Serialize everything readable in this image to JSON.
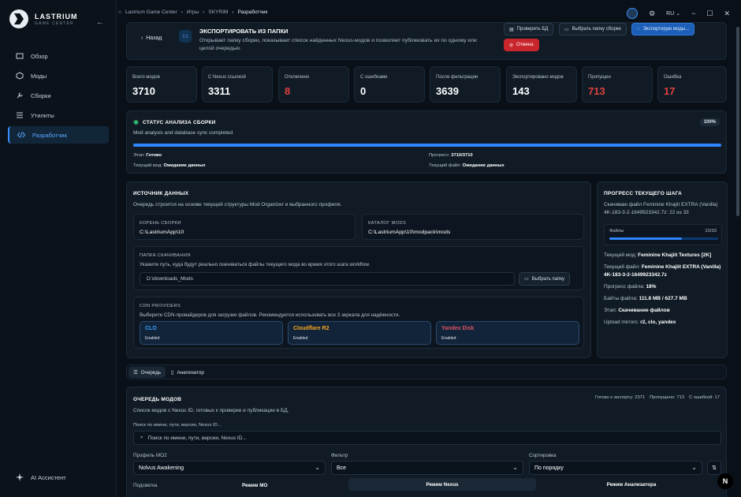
{
  "app": {
    "logo_name": "LASTRIUM",
    "logo_sub": "GAME CENTER"
  },
  "sidebar": {
    "items": [
      {
        "label": "Обзор",
        "icon": "overview-icon"
      },
      {
        "label": "Моды",
        "icon": "cube-icon"
      },
      {
        "label": "Сборки",
        "icon": "wrench-icon"
      },
      {
        "label": "Утилиты",
        "icon": "sliders-icon"
      },
      {
        "label": "Разработчик",
        "icon": "code-icon"
      }
    ],
    "ai_label": "AI Ассистент"
  },
  "breadcrumbs": [
    "Lastrium Game Center",
    "Игры",
    "SKYRIM",
    "Разработчик"
  ],
  "topbar": {
    "lang": "RU"
  },
  "header": {
    "back_label": "Назад",
    "title": "ЭКСПОРТИРОВАТЬ ИЗ ПАПКИ",
    "description": "Открывает папку сборки, показывает список найденных Nexus-модов и позволяет публиковать их по одному или целой очередью.",
    "btn_check_db": "Проверить БД",
    "btn_choose_folder": "Выбрать папку сборки",
    "btn_exporting": "Экспортирую моды...",
    "btn_cancel": "Отмена"
  },
  "stats": [
    {
      "label": "Всего модов",
      "value": "3710",
      "red": false
    },
    {
      "label": "С Nexus ссылкой",
      "value": "3311",
      "red": false
    },
    {
      "label": "Отключено",
      "value": "8",
      "red": true
    },
    {
      "label": "С ошибками",
      "value": "0",
      "red": false
    },
    {
      "label": "После фильтрации",
      "value": "3639",
      "red": false
    },
    {
      "label": "Экспортировано модов",
      "value": "143",
      "red": false
    },
    {
      "label": "Пропущен",
      "value": "713",
      "red": true
    },
    {
      "label": "Ошибка",
      "value": "17",
      "red": true
    }
  ],
  "status": {
    "title": "СТАТУС АНАЛИЗА СБОРКИ",
    "subtitle": "Mod analysis and database sync completed",
    "percent_label": "100%",
    "progress": 1.0,
    "stage_label": "Этап:",
    "stage_value": "Готово",
    "progress_label": "Прогресс:",
    "progress_value": "3710/3710",
    "current_mod_label": "Текущий мод:",
    "current_mod_value": "Ожидание данных",
    "current_file_label": "Текущий файл:",
    "current_file_value": "Ожидание данных"
  },
  "source": {
    "title": "ИСТОЧНИК ДАННЫХ",
    "subtitle": "Очередь строится на основе текущей структуры Mod Organizer и выбранного профиля.",
    "root_label": "КОРЕНЬ СБОРКИ",
    "root_value": "C:\\LastriumApp\\10",
    "mods_label": "КАТАЛОГ MODS",
    "mods_value": "C:\\LastriumApp\\10\\modpack\\mods",
    "download_title": "ПАПКА СКАЧИВАНИЯ",
    "download_desc": "Укажите путь, куда будут реально скачиваться файлы текущего мода во время этого шага workflow.",
    "download_value": "D:\\downloads_Mods",
    "choose_folder": "Выбрать папку",
    "cdn_title": "CDN PROVIDERS",
    "cdn_desc": "Выберите CDN-провайдеров для загрузки файлов. Рекомендуется использовать все 3 зеркала для надёжности.",
    "cdn": [
      {
        "name": "CLO",
        "state": "Enabled",
        "color": "#3aa0ff"
      },
      {
        "name": "Cloudflare R2",
        "state": "Enabled",
        "color": "#f5a623"
      },
      {
        "name": "Yandex Disk",
        "state": "Enabled",
        "color": "#e05263"
      }
    ]
  },
  "step": {
    "title": "ПРОГРЕСС ТЕКУЩЕГО ШАГА",
    "downloading": "Скачиваю файл Feminine Khajiit EXTRA (Vanilla) 4K-183-3-2-1649923342.7z: 22 из 33",
    "files_label": "Файлы",
    "files_count": "22/33",
    "files_progress": 0.667,
    "mod_label": "Текущий мод:",
    "mod_value": "Feminine Khajiit Textures [2K]",
    "file_label": "Текущий файл:",
    "file_value": "Feminine Khajiit EXTRA (Vanilla) 4K-183-3-2-1649923342.7z",
    "fprog_label": "Прогресс файла:",
    "fprog_value": "18%",
    "bytes_label": "Байты файла:",
    "bytes_value": "111.8 MB / 627.7 MB",
    "stage_label": "Этап:",
    "stage_value": "Скачивание файлов",
    "mirrors_label": "Upload mirrors:",
    "mirrors_value": "r2, clo, yandex"
  },
  "tabs": [
    {
      "label": "Очередь"
    },
    {
      "label": "Анализатор"
    }
  ],
  "queue": {
    "title": "ОЧЕРЕДЬ МОДОВ",
    "subtitle": "Список модов с Nexus ID, готовых к проверке и публикации в БД.",
    "ready": "Готово к экспорту: 2371",
    "skipped": "Пропущено: 713",
    "errors": "С ошибкой: 17",
    "search_label": "Поиск по имени, пути, версии, Nexus ID...",
    "search_placeholder": "Поиск по имени, пути, версии, Nexus ID...",
    "profile_label": "Профиль MO2",
    "profile_value": "Nolvus Awakening",
    "filter_label": "Фильтр",
    "filter_value": "Все",
    "sort_label": "Сортировка",
    "sort_value": "По порядку",
    "highlight_label": "Подсветка",
    "mode_mo": "Режим MO",
    "mode_nexus": "Режим Nexus",
    "mode_analyzer": "Режим Анализатора"
  }
}
